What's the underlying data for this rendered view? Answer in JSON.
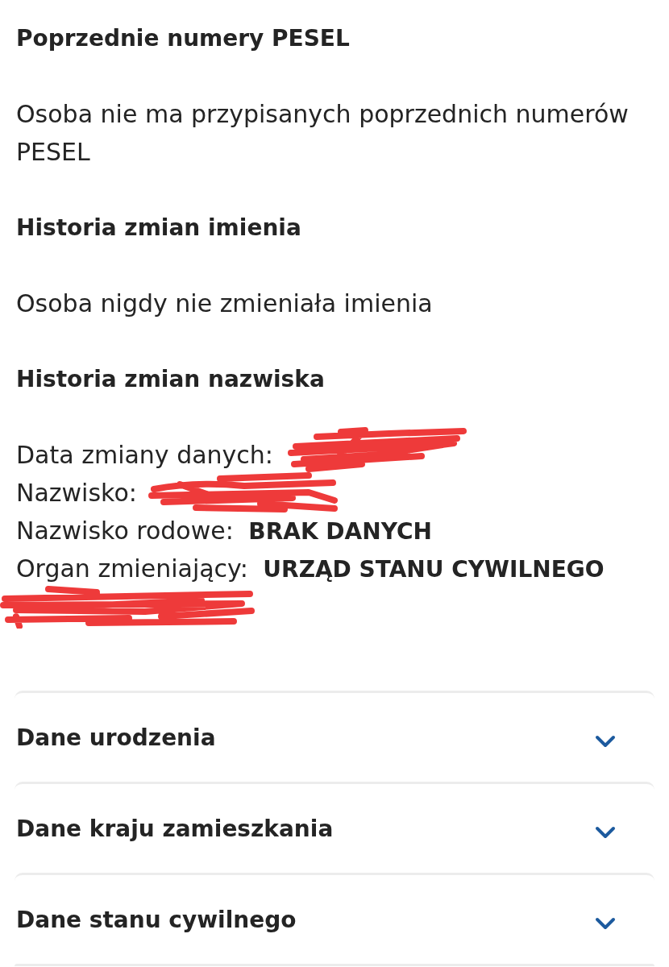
{
  "sections": [
    {
      "heading": "Poprzednie numery PESEL",
      "text": "Osoba nie ma przypisanych poprzednich numerów PESEL"
    },
    {
      "heading": "Historia zmian imienia",
      "text": "Osoba nigdy nie zmieniała imienia"
    },
    {
      "heading": "Historia zmian nazwiska",
      "details": [
        {
          "label": "Data zmiany danych:",
          "redacted": true,
          "continuation_redacted": false
        },
        {
          "label": "Nazwisko:",
          "redacted": true,
          "continuation_redacted": false
        },
        {
          "label": "Nazwisko rodowe:",
          "value": "BRAK DANYCH",
          "redacted": false,
          "continuation_redacted": false
        },
        {
          "label": "Organ zmieniający:",
          "value": "URZĄD STANU CYWILNEGO",
          "redacted": false,
          "continuation_redacted": true
        }
      ]
    }
  ],
  "accordion": [
    {
      "title": "Dane urodzenia",
      "expanded": false
    },
    {
      "title": "Dane kraju zamieszkania",
      "expanded": false
    },
    {
      "title": "Dane stanu cywilnego",
      "expanded": false
    }
  ]
}
